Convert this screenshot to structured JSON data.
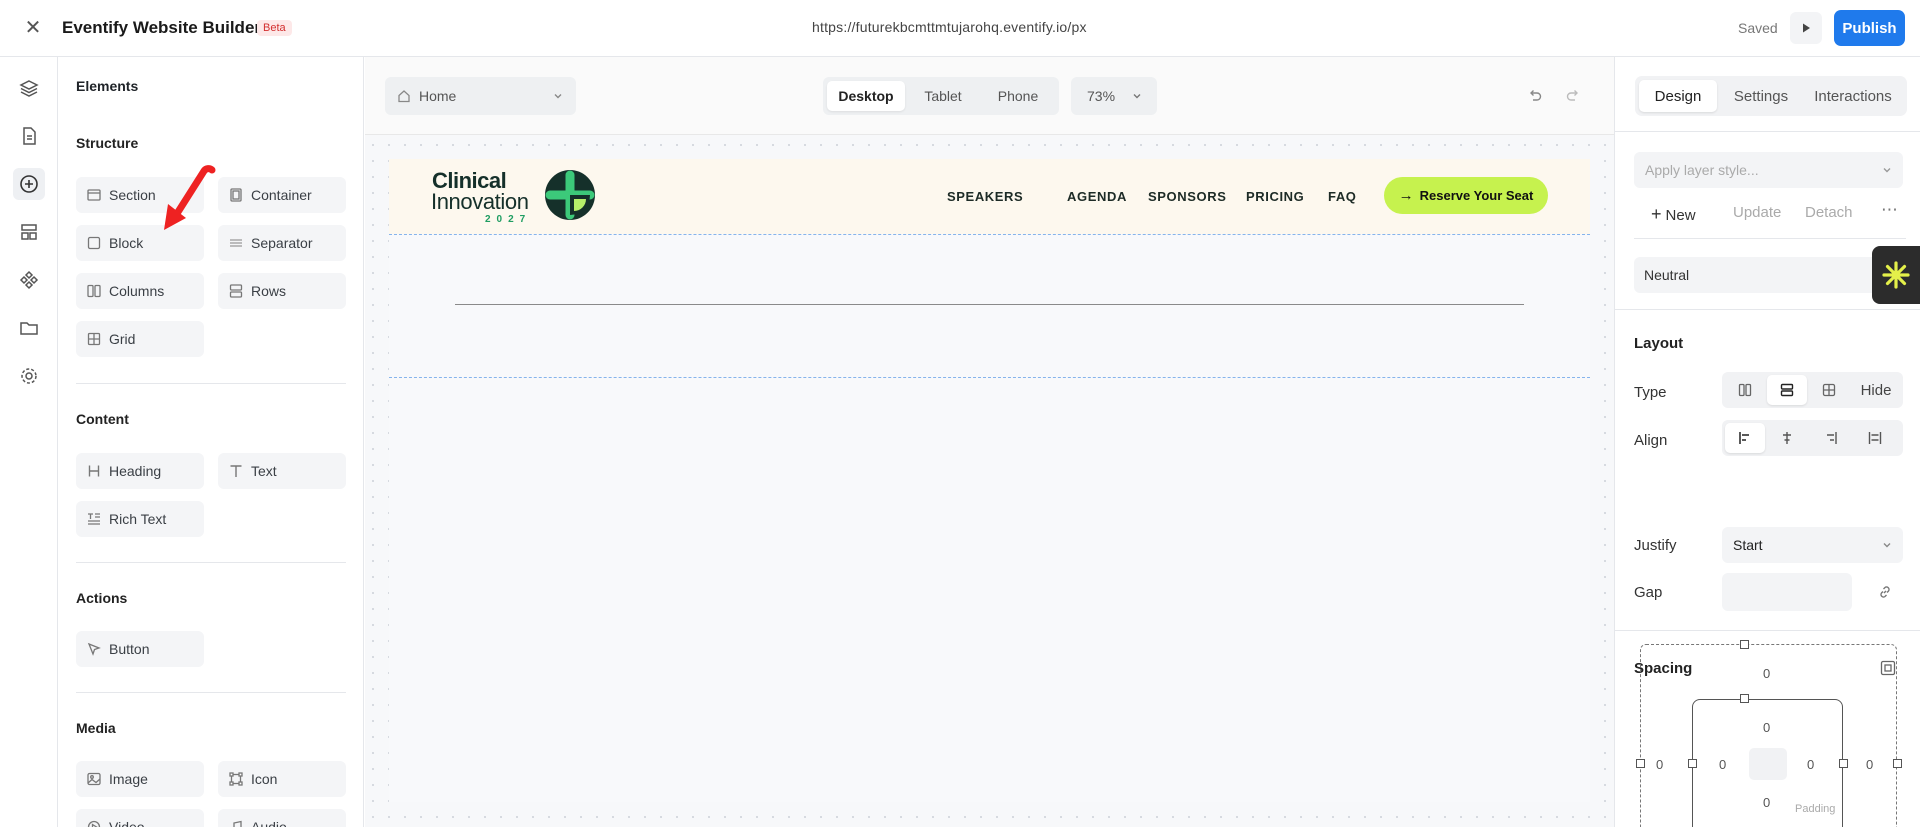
{
  "topbar": {
    "close_icon": "close-icon",
    "app_title": "Eventify Website Builder",
    "beta_badge": "Beta",
    "url": "https://futurekbcmttmtujarohq.eventify.io/px",
    "saved_status": "Saved",
    "preview_icon": "play-icon",
    "publish_label": "Publish",
    "publish_color": "#1f7aec"
  },
  "icon_rail": [
    "layers-icon",
    "page-icon",
    "add-element-icon",
    "layout-icon",
    "components-icon",
    "folder-icon",
    "settings-icon"
  ],
  "left_panel": {
    "title": "Elements",
    "sections": [
      {
        "heading": "Structure",
        "items": [
          "Section",
          "Container",
          "Block",
          "Separator",
          "Columns",
          "Rows",
          "Grid"
        ]
      },
      {
        "heading": "Content",
        "items": [
          "Heading",
          "Text",
          "Rich Text"
        ]
      },
      {
        "heading": "Actions",
        "items": [
          "Button"
        ]
      },
      {
        "heading": "Media",
        "items": [
          "Image",
          "Icon",
          "Video",
          "Audio"
        ]
      }
    ]
  },
  "canvas_toolbar": {
    "page": "Home",
    "devices": [
      "Desktop",
      "Tablet",
      "Phone"
    ],
    "active_device": "Desktop",
    "zoom": "73%"
  },
  "site": {
    "logo_line1": "Clinical",
    "logo_line2": "Innovation",
    "logo_year": "2027",
    "nav": [
      "SPEAKERS",
      "AGENDA",
      "SPONSORS",
      "PRICING",
      "FAQ"
    ],
    "cta_label": "Reserve Your Seat",
    "cta_color": "#c6f24e",
    "nav_bg": "#fdf8ee"
  },
  "right_panel": {
    "tabs": [
      "Design",
      "Settings",
      "Interactions"
    ],
    "active_tab": "Design",
    "layer_style_placeholder": "Apply layer style...",
    "actions": {
      "new": "New",
      "update": "Update",
      "detach": "Detach"
    },
    "neutral": "Neutral",
    "layout": {
      "heading": "Layout",
      "type_label": "Type",
      "type_hide": "Hide",
      "align_label": "Align",
      "justify_label": "Justify",
      "justify_value": "Start",
      "gap_label": "Gap"
    },
    "spacing": {
      "heading": "Spacing",
      "margin_top": "0",
      "margin_left": "0",
      "margin_right": "0",
      "padding_top": "0",
      "padding_left": "0",
      "padding_right": "0",
      "padding_bottom": "0",
      "padding_label": "Padding"
    }
  }
}
